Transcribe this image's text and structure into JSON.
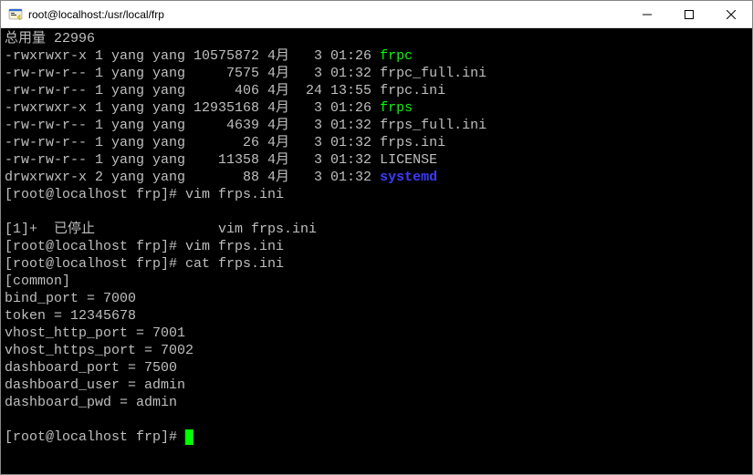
{
  "window": {
    "title": "root@localhost:/usr/local/frp"
  },
  "header_line": "总用量 22996",
  "files": [
    {
      "perm": "-rwxrwxr-x",
      "links": "1",
      "owner": "yang",
      "group": "yang",
      "size": "10575872",
      "month": "4月",
      "day": " 3",
      "time": "01:26",
      "name": "frpc",
      "cls": "green"
    },
    {
      "perm": "-rw-rw-r--",
      "links": "1",
      "owner": "yang",
      "group": "yang",
      "size": "    7575",
      "month": "4月",
      "day": " 3",
      "time": "01:32",
      "name": "frpc_full.ini",
      "cls": ""
    },
    {
      "perm": "-rw-rw-r--",
      "links": "1",
      "owner": "yang",
      "group": "yang",
      "size": "     406",
      "month": "4月",
      "day": "24",
      "time": "13:55",
      "name": "frpc.ini",
      "cls": ""
    },
    {
      "perm": "-rwxrwxr-x",
      "links": "1",
      "owner": "yang",
      "group": "yang",
      "size": "12935168",
      "month": "4月",
      "day": " 3",
      "time": "01:26",
      "name": "frps",
      "cls": "green"
    },
    {
      "perm": "-rw-rw-r--",
      "links": "1",
      "owner": "yang",
      "group": "yang",
      "size": "    4639",
      "month": "4月",
      "day": " 3",
      "time": "01:32",
      "name": "frps_full.ini",
      "cls": ""
    },
    {
      "perm": "-rw-rw-r--",
      "links": "1",
      "owner": "yang",
      "group": "yang",
      "size": "      26",
      "month": "4月",
      "day": " 3",
      "time": "01:32",
      "name": "frps.ini",
      "cls": ""
    },
    {
      "perm": "-rw-rw-r--",
      "links": "1",
      "owner": "yang",
      "group": "yang",
      "size": "   11358",
      "month": "4月",
      "day": " 3",
      "time": "01:32",
      "name": "LICENSE",
      "cls": ""
    },
    {
      "perm": "drwxrwxr-x",
      "links": "2",
      "owner": "yang",
      "group": "yang",
      "size": "      88",
      "month": "4月",
      "day": " 3",
      "time": "01:32",
      "name": "systemd",
      "cls": "bluebold"
    }
  ],
  "prompt": "[root@localhost frp]# ",
  "cmd1": "vim frps.ini",
  "stopped_line": "[1]+  已停止               vim frps.ini",
  "cmd2": "vim frps.ini",
  "cmd3": "cat frps.ini",
  "config_lines": [
    "[common]",
    "bind_port = 7000",
    "token = 12345678",
    "vhost_http_port = 7001",
    "vhost_https_port = 7002",
    "dashboard_port = 7500",
    "dashboard_user = admin",
    "dashboard_pwd = admin"
  ]
}
